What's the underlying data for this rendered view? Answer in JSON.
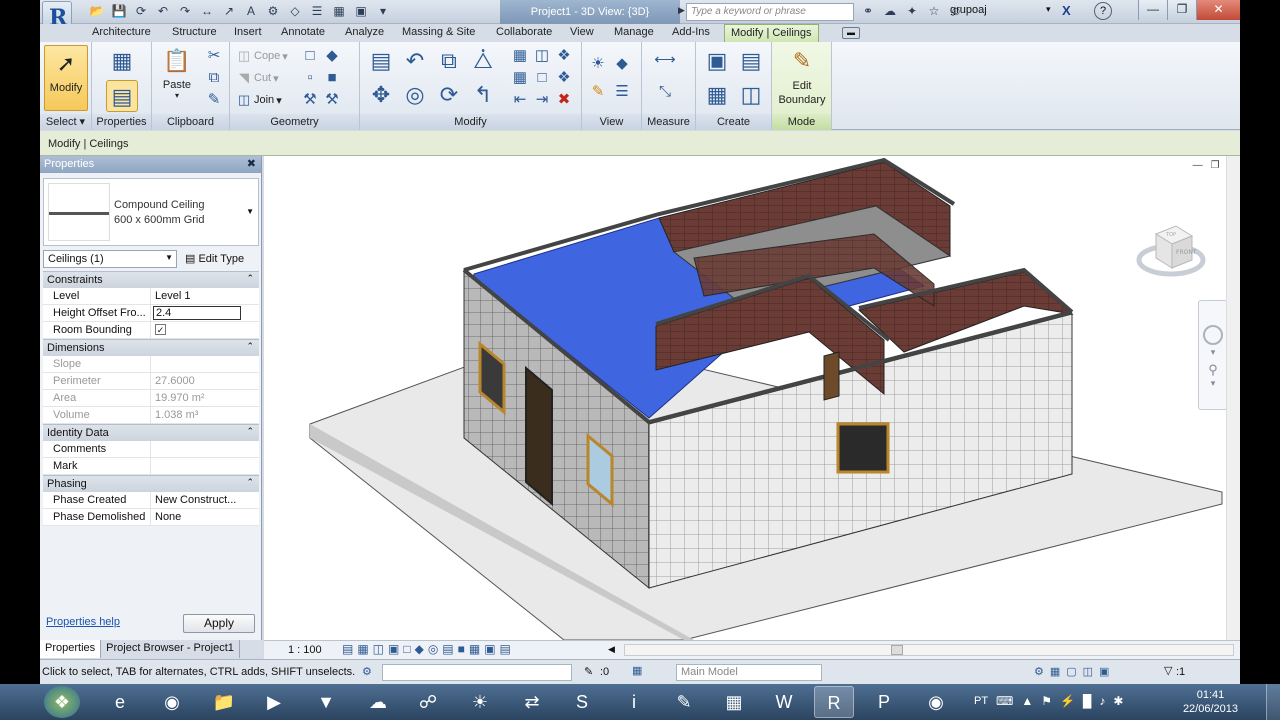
{
  "app": {
    "logo_letter": "R",
    "doc_title": "Project1 - 3D View: {3D}",
    "search_placeholder": "Type a keyword or phrase",
    "user": "grupoaj"
  },
  "tabs": [
    "Architecture",
    "Structure",
    "Insert",
    "Annotate",
    "Analyze",
    "Massing & Site",
    "Collaborate",
    "View",
    "Manage",
    "Add-Ins",
    "Modify | Ceilings"
  ],
  "ribbon": {
    "modify_label": "Modify",
    "select_label": "Select",
    "properties_label": "Properties",
    "paste_label": "Paste",
    "clipboard_label": "Clipboard",
    "cope_label": "Cope",
    "cut_label": "Cut",
    "join_label": "Join",
    "geometry_label": "Geometry",
    "modify_panel_label": "Modify",
    "view_label": "View",
    "measure_label": "Measure",
    "create_label": "Create",
    "edit_boundary_label": "Edit Boundary",
    "mode_label": "Mode"
  },
  "context_label": "Modify | Ceilings",
  "properties": {
    "title": "Properties",
    "type_family": "Compound Ceiling",
    "type_name": "600 x 600mm Grid",
    "selector": "Ceilings (1)",
    "edit_type": "Edit Type",
    "sections": [
      {
        "title": "Constraints",
        "rows": [
          {
            "k": "Level",
            "v": "Level 1",
            "dim": false
          },
          {
            "k": "Height Offset Fro...",
            "v": "2.4",
            "dim": false,
            "edit": true
          },
          {
            "k": "Room Bounding",
            "v": "✓",
            "dim": false,
            "check": true
          }
        ]
      },
      {
        "title": "Dimensions",
        "rows": [
          {
            "k": "Slope",
            "v": "",
            "dim": true
          },
          {
            "k": "Perimeter",
            "v": "27.6000",
            "dim": true
          },
          {
            "k": "Area",
            "v": "19.970 m²",
            "dim": true
          },
          {
            "k": "Volume",
            "v": "1.038 m³",
            "dim": true
          }
        ]
      },
      {
        "title": "Identity Data",
        "rows": [
          {
            "k": "Comments",
            "v": "",
            "dim": false
          },
          {
            "k": "Mark",
            "v": "",
            "dim": false
          }
        ]
      },
      {
        "title": "Phasing",
        "rows": [
          {
            "k": "Phase Created",
            "v": "New Construct...",
            "dim": false
          },
          {
            "k": "Phase Demolished",
            "v": "None",
            "dim": false
          }
        ]
      }
    ],
    "help_link": "Properties help",
    "apply": "Apply"
  },
  "bottom_tabs": [
    "Properties",
    "Project Browser - Project1"
  ],
  "view_scale": "1 : 100",
  "viewcube": {
    "top": "TOP",
    "front": "FRONT"
  },
  "status": {
    "text": "Click to select, TAB for alternates, CTRL adds, SHIFT unselects.",
    "workset_value": ":0",
    "model": "Main Model",
    "filter_count": ":1"
  },
  "taskbar": {
    "lang": "PT",
    "time": "01:41",
    "date": "22/06/2013"
  },
  "colors": {
    "ceiling_blue": "#3f66e0",
    "brick": "#6a3b35",
    "tile": "#e7e7e7",
    "accent_green": "#cfe6b2"
  }
}
